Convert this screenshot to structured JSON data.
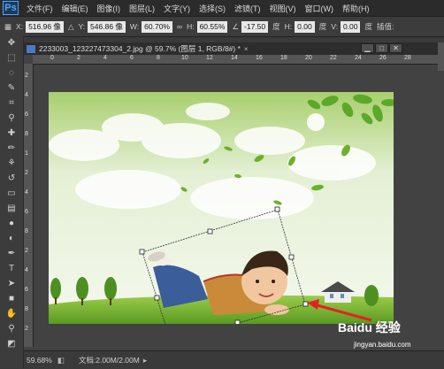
{
  "app": {
    "logo": "Ps"
  },
  "menus": [
    "文件(F)",
    "编辑(E)",
    "图像(I)",
    "图层(L)",
    "文字(Y)",
    "选择(S)",
    "滤镜(T)",
    "视图(V)",
    "窗口(W)",
    "帮助(H)"
  ],
  "options": {
    "x_label": "X:",
    "x_value": "516.96 像",
    "y_label": "Y:",
    "y_value": "546.86 像",
    "w_label": "W:",
    "w_value": "60.70%",
    "h_label": "H:",
    "h_value": "60.55%",
    "angle_value": "-17.50",
    "angle_unit": "度",
    "hskew_label": "H:",
    "hskew_value": "0.00",
    "hskew_unit": "度",
    "vskew_label": "V:",
    "vskew_value": "0.00",
    "vskew_unit": "度",
    "interp_label": "插值:"
  },
  "document": {
    "tab_title": "2233003_123227473304_2.jpg @ 59.7% (图层 1, RGB/8#) *",
    "close": "×",
    "ruler_h": [
      "0",
      "2",
      "4",
      "6",
      "8",
      "10",
      "12",
      "14",
      "16",
      "18",
      "20",
      "22",
      "24",
      "26",
      "28"
    ],
    "ruler_v": [
      "2",
      "4",
      "6",
      "8",
      "1",
      "2",
      "4",
      "6",
      "8",
      "2",
      "4",
      "6",
      "8",
      "2",
      "2"
    ]
  },
  "status": {
    "zoom": "59.68%",
    "doc_info": "文档:2.00M/2.00M"
  },
  "watermark": {
    "brand": "Baidu 经验",
    "url": "jingyan.baidu.com"
  }
}
